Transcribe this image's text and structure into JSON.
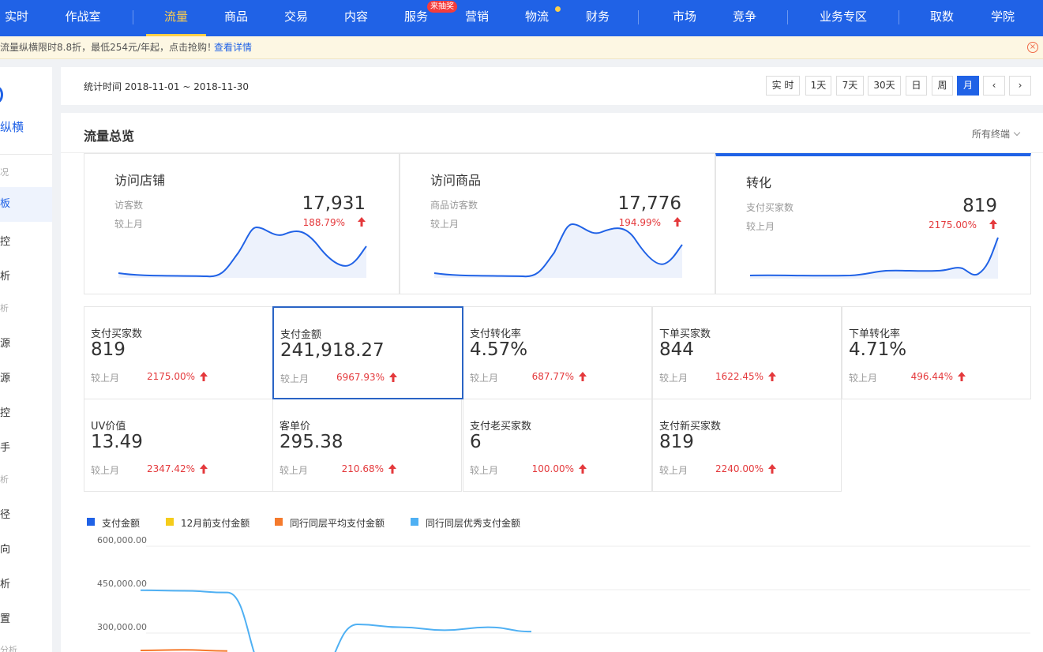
{
  "topnav": {
    "items": [
      "实时",
      "作战室",
      "流量",
      "商品",
      "交易",
      "内容",
      "服务",
      "营销",
      "物流",
      "财务",
      "市场",
      "竞争",
      "业务专区",
      "取数",
      "学院"
    ],
    "active": "流量",
    "service_badge": "来抽奖"
  },
  "promo": {
    "text": "流量纵横限时8.8折，最低254元/年起，点击抢购！",
    "link": "查看详情",
    "close_icon": "close-circle-icon"
  },
  "sidebar": {
    "brand": "纵横",
    "entries": [
      "况",
      "板",
      "控",
      "析",
      "析",
      "源",
      "源",
      "控",
      "手",
      "析",
      "径",
      "向",
      "析",
      "置",
      "分析"
    ]
  },
  "datebar": {
    "label": "统计时间 2018-11-01 ~ 2018-11-30",
    "buttons": [
      "实 时",
      "1天",
      "7天",
      "30天",
      "日",
      "周",
      "月",
      "‹",
      "›"
    ],
    "active": "月"
  },
  "overview": {
    "title": "流量总览",
    "terminal": "所有终端",
    "cards": [
      {
        "title": "访问店铺",
        "label": "访客数",
        "value": "17,931",
        "compare": "较上月",
        "pct": "188.79%"
      },
      {
        "title": "访问商品",
        "label": "商品访客数",
        "value": "17,776",
        "compare": "较上月",
        "pct": "194.99%"
      },
      {
        "title": "转化",
        "label": "支付买家数",
        "value": "819",
        "compare": "较上月",
        "pct": "2175.00%"
      }
    ]
  },
  "metrics": [
    {
      "name": "支付买家数",
      "value": "819",
      "compare": "较上月",
      "pct": "2175.00%"
    },
    {
      "name": "支付金额",
      "value": "241,918.27",
      "compare": "较上月",
      "pct": "6967.93%"
    },
    {
      "name": "支付转化率",
      "value": "4.57%",
      "compare": "较上月",
      "pct": "687.77%"
    },
    {
      "name": "下单买家数",
      "value": "844",
      "compare": "较上月",
      "pct": "1622.45%"
    },
    {
      "name": "下单转化率",
      "value": "4.71%",
      "compare": "较上月",
      "pct": "496.44%"
    },
    {
      "name": "UV价值",
      "value": "13.49",
      "compare": "较上月",
      "pct": "2347.42%"
    },
    {
      "name": "客单价",
      "value": "295.38",
      "compare": "较上月",
      "pct": "210.68%"
    },
    {
      "name": "支付老买家数",
      "value": "6",
      "compare": "较上月",
      "pct": "100.00%"
    },
    {
      "name": "支付新买家数",
      "value": "819",
      "compare": "较上月",
      "pct": "2240.00%"
    }
  ],
  "legend": [
    {
      "name": "支付金额",
      "color": "#2062e6"
    },
    {
      "name": "12月前支付金额",
      "color": "#f5cc1a"
    },
    {
      "name": "同行同层平均支付金额",
      "color": "#f57a2c"
    },
    {
      "name": "同行同层优秀支付金额",
      "color": "#4fb0f3"
    }
  ],
  "chart_data": {
    "type": "line",
    "yticks": [
      "600,000.00",
      "450,000.00",
      "300,000.00"
    ],
    "ylim": [
      150000,
      600000
    ],
    "x_index": [
      0,
      1,
      2,
      3,
      4,
      5,
      6,
      7,
      8,
      9,
      10,
      11
    ],
    "series": [
      {
        "name": "同行同层优秀支付金额",
        "color": "#4fb0f3",
        "x": [
          0,
          1,
          2,
          3,
          4,
          5,
          6,
          7,
          8,
          9
        ],
        "values": [
          448000,
          446000,
          440000,
          150000,
          150000,
          330000,
          320000,
          310000,
          320000,
          305000
        ]
      },
      {
        "name": "同行同层平均支付金额",
        "color": "#f57a2c",
        "x": [
          0,
          1,
          2
        ],
        "values": [
          240000,
          242000,
          238000
        ]
      }
    ]
  }
}
